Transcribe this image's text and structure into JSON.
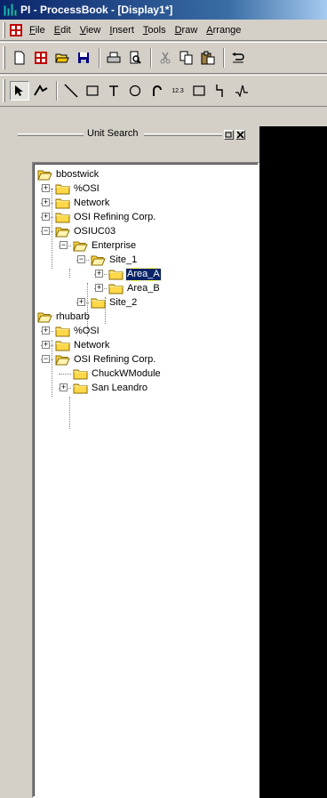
{
  "window": {
    "title": "PI - ProcessBook - [Display1*]"
  },
  "menu": [
    {
      "label": "File",
      "key": "F"
    },
    {
      "label": "Edit",
      "key": "E"
    },
    {
      "label": "View",
      "key": "V"
    },
    {
      "label": "Insert",
      "key": "I"
    },
    {
      "label": "Tools",
      "key": "T"
    },
    {
      "label": "Draw",
      "key": "D"
    },
    {
      "label": "Arrange",
      "key": "A"
    }
  ],
  "toolbar_standard": [
    "new-icon",
    "display-icon",
    "open-icon",
    "save-icon",
    "print-icon",
    "print-preview-icon",
    "cut-icon",
    "copy-icon",
    "paste-icon",
    "undo-icon"
  ],
  "toolbar_draw": [
    "select-arrow-icon",
    "run-mode-icon",
    "line-icon",
    "rectangle-icon",
    "text-icon",
    "ellipse-icon",
    "arc-icon",
    "value-icon",
    "button-icon",
    "connector-icon",
    "trend-icon"
  ],
  "toolbar_draw_value_label": "12.3",
  "panel": {
    "title": "Unit Search"
  },
  "tree": [
    {
      "label": "bbostwick",
      "level": 0,
      "expander": "none",
      "open": true
    },
    {
      "label": "%OSI",
      "level": 1,
      "expander": "+",
      "open": false
    },
    {
      "label": "Network",
      "level": 1,
      "expander": "+",
      "open": false
    },
    {
      "label": "OSI Refining Corp.",
      "level": 1,
      "expander": "+",
      "open": false
    },
    {
      "label": "OSIUC03",
      "level": 1,
      "expander": "-",
      "open": true
    },
    {
      "label": "Enterprise",
      "level": 2,
      "expander": "-",
      "open": true
    },
    {
      "label": "Site_1",
      "level": 3,
      "expander": "-",
      "open": true
    },
    {
      "label": "Area_A",
      "level": 4,
      "expander": "+",
      "open": false,
      "selected": true
    },
    {
      "label": "Area_B",
      "level": 4,
      "expander": "+",
      "open": false
    },
    {
      "label": "Site_2",
      "level": 3,
      "expander": "+",
      "open": false
    },
    {
      "label": "rhubarb",
      "level": 0,
      "expander": "none",
      "open": true
    },
    {
      "label": "%OSI",
      "level": 1,
      "expander": "+",
      "open": false
    },
    {
      "label": "Network",
      "level": 1,
      "expander": "+",
      "open": false
    },
    {
      "label": "OSI Refining Corp.",
      "level": 1,
      "expander": "-",
      "open": true
    },
    {
      "label": "ChuckWModule",
      "level": 2,
      "expander": "none",
      "open": false
    },
    {
      "label": "San Leandro",
      "level": 2,
      "expander": "+",
      "open": false
    }
  ],
  "colors": {
    "titlebar": "#0a246a",
    "chrome": "#d4d0c8",
    "folder": "#ffd84a",
    "selection": "#0a246a",
    "canvas": "#000000"
  }
}
